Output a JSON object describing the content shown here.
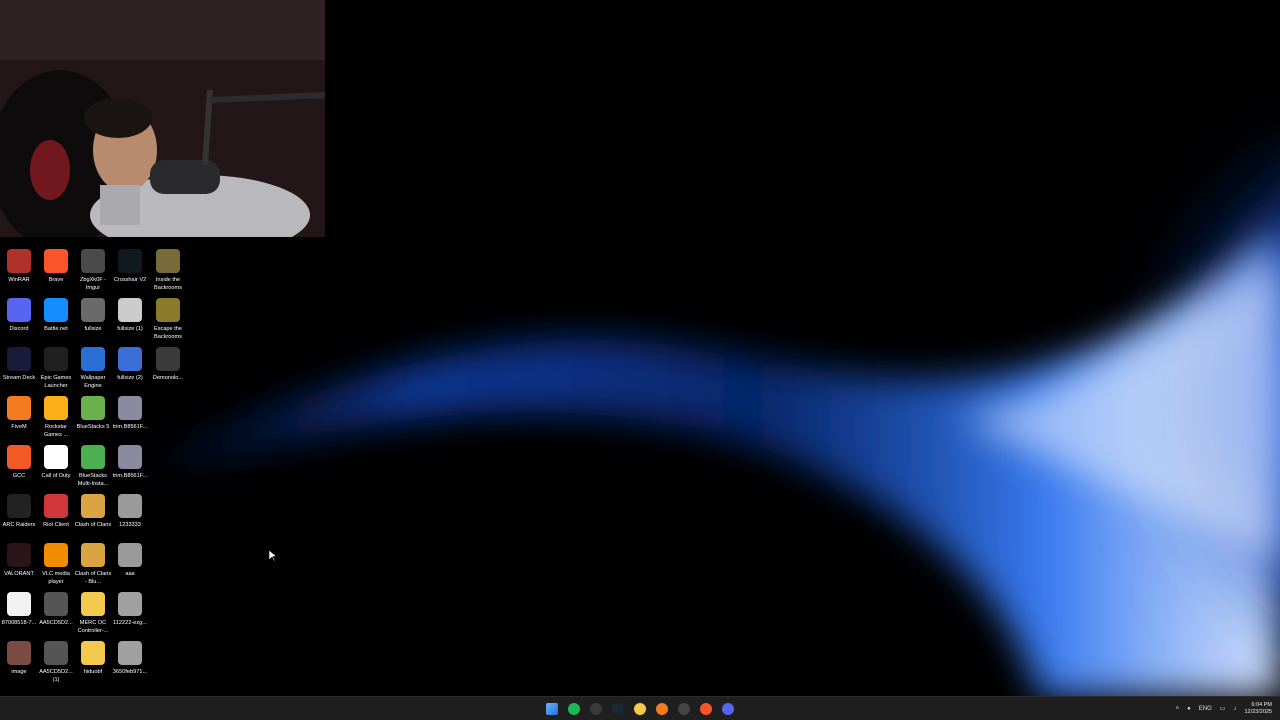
{
  "desktop": {
    "columns": [
      [
        {
          "label": "WinRAR",
          "icon": "winrar-icon",
          "color": "#b0302a"
        },
        {
          "label": "Discord",
          "icon": "discord-icon",
          "color": "#5865f2"
        },
        {
          "label": "Stream Deck",
          "icon": "stream-deck-icon",
          "color": "#1a1a3a"
        },
        {
          "label": "FiveM",
          "icon": "fivem-icon",
          "color": "#f47b20"
        },
        {
          "label": "GCC",
          "icon": "gcc-icon",
          "color": "#f15a24"
        },
        {
          "label": "ARC Raiders",
          "icon": "arc-raiders-icon",
          "color": "#222222"
        },
        {
          "label": "VALORANT",
          "icon": "valorant-icon",
          "color": "#2b1418"
        },
        {
          "label": "87008518-7...",
          "icon": "image-file-icon",
          "color": "#f2f2f2"
        },
        {
          "label": "image",
          "icon": "image-file-icon",
          "color": "#7a4a44"
        }
      ],
      [
        {
          "label": "Brave",
          "icon": "brave-icon",
          "color": "#fb542b"
        },
        {
          "label": "Battle.net",
          "icon": "battle-net-icon",
          "color": "#148eff"
        },
        {
          "label": "Epic Games Launcher",
          "icon": "epic-games-icon",
          "color": "#202020"
        },
        {
          "label": "Rockstar Games ...",
          "icon": "rockstar-icon",
          "color": "#fcaf17"
        },
        {
          "label": "Call of Duty",
          "icon": "call-of-duty-icon",
          "color": "#ffffff"
        },
        {
          "label": "Riot Client",
          "icon": "riot-client-icon",
          "color": "#d13639"
        },
        {
          "label": "VLC media player",
          "icon": "vlc-icon",
          "color": "#f08c00"
        },
        {
          "label": "AA5CD5D2...",
          "icon": "image-file-icon",
          "color": "#555555"
        },
        {
          "label": "AA5CD5D2... (1)",
          "icon": "image-file-icon",
          "color": "#555555"
        }
      ],
      [
        {
          "label": "ZbgXk0F - Imgur",
          "icon": "image-file-icon",
          "color": "#4a4a4a"
        },
        {
          "label": "fullsize",
          "icon": "image-file-icon",
          "color": "#6a6a6a"
        },
        {
          "label": "Wallpaper Engine",
          "icon": "wallpaper-engine-icon",
          "color": "#2a6fd6"
        },
        {
          "label": "BlueStacks 5",
          "icon": "bluestacks-icon",
          "color": "#6ab04c"
        },
        {
          "label": "BlueStacks Multi-Insta...",
          "icon": "bluestacks-multi-icon",
          "color": "#4caf50"
        },
        {
          "label": "Clash of Clans",
          "icon": "clash-of-clans-icon",
          "color": "#d9a441"
        },
        {
          "label": "Clash of Clans - Blu...",
          "icon": "clash-of-clans-icon",
          "color": "#d9a441"
        },
        {
          "label": "MERC OC Controller-...",
          "icon": "folder-icon",
          "color": "#f2c94c"
        },
        {
          "label": "hiduobf",
          "icon": "folder-icon",
          "color": "#f2c94c"
        }
      ],
      [
        {
          "label": "Crosshair V2",
          "icon": "crosshair-icon",
          "color": "#101820"
        },
        {
          "label": "fullsize (1)",
          "icon": "image-file-icon",
          "color": "#cccccc"
        },
        {
          "label": "fullsize (2)",
          "icon": "image-file-icon",
          "color": "#3a6fd8"
        },
        {
          "label": "trim.B8561F...",
          "icon": "video-file-icon",
          "color": "#8a8aa0"
        },
        {
          "label": "trim.B8561F...",
          "icon": "video-file-icon",
          "color": "#8a8aa0"
        },
        {
          "label": "1233333",
          "icon": "image-file-icon",
          "color": "#9a9a9a"
        },
        {
          "label": "aaa",
          "icon": "image-file-icon",
          "color": "#9a9a9a"
        },
        {
          "label": "112222-ezg...",
          "icon": "image-file-icon",
          "color": "#a0a0a0"
        },
        {
          "label": "3650feb971...",
          "icon": "image-file-icon",
          "color": "#a0a0a0"
        }
      ],
      [
        {
          "label": "Inside the Backrooms",
          "icon": "inside-backrooms-icon",
          "color": "#7a6a3a"
        },
        {
          "label": "Escape the Backrooms",
          "icon": "escape-backrooms-icon",
          "color": "#8a7a2a"
        },
        {
          "label": "Demonolo...",
          "icon": "demonologist-icon",
          "color": "#3a3a3a"
        }
      ]
    ]
  },
  "taskbar": {
    "apps": [
      {
        "name": "start-button",
        "color": "#3d8bff"
      },
      {
        "name": "spotify-icon",
        "color": "#1db954"
      },
      {
        "name": "store-icon",
        "color": "#3a3a3a"
      },
      {
        "name": "steam-icon",
        "color": "#1b2838"
      },
      {
        "name": "file-explorer-icon",
        "color": "#f2c94c"
      },
      {
        "name": "fivem-icon",
        "color": "#f47b20"
      },
      {
        "name": "obs-icon",
        "color": "#444444"
      },
      {
        "name": "brave-icon",
        "color": "#fb542b"
      },
      {
        "name": "discord-icon",
        "color": "#5865f2"
      }
    ],
    "tray": {
      "language": "ENG",
      "time": "6:04 PM",
      "date": "12/23/2025"
    }
  }
}
